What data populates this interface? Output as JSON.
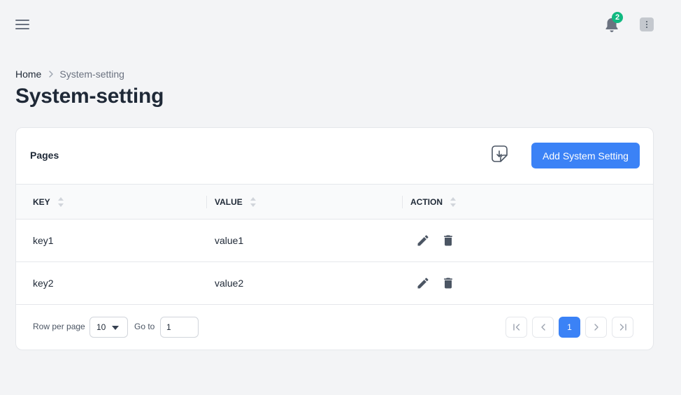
{
  "header": {
    "menu_icon": "hamburger-icon",
    "notification_icon": "bell-icon",
    "notification_count": "2",
    "more_icon": "kebab-menu-icon"
  },
  "breadcrumb": {
    "items": [
      "Home",
      "System-setting"
    ],
    "separator_icon": "chevron-right-icon"
  },
  "page_title": "System-setting",
  "card": {
    "title": "Pages",
    "export_icon": "export-file-icon",
    "add_button_label": "Add System Setting"
  },
  "table": {
    "columns": [
      {
        "label": "KEY",
        "sort_icon": "sort-icon"
      },
      {
        "label": "VALUE",
        "sort_icon": "sort-icon"
      },
      {
        "label": "ACTION",
        "sort_icon": "sort-icon"
      }
    ],
    "rows": [
      {
        "key": "key1",
        "value": "value1",
        "actions": [
          "edit-icon",
          "delete-icon"
        ]
      },
      {
        "key": "key2",
        "value": "value2",
        "actions": [
          "edit-icon",
          "delete-icon"
        ]
      }
    ]
  },
  "pagination": {
    "rows_per_page_label": "Row per page",
    "rows_per_page_value": "10",
    "goto_label": "Go to",
    "goto_value": "1",
    "current_page": "1",
    "nav_icons": [
      "first-page-icon",
      "prev-page-icon",
      "next-page-icon",
      "last-page-icon"
    ]
  },
  "colors": {
    "primary": "#3b82f6",
    "badge": "#10b981",
    "background": "#f3f4f6",
    "text": "#1f2937",
    "muted": "#6b7280"
  }
}
